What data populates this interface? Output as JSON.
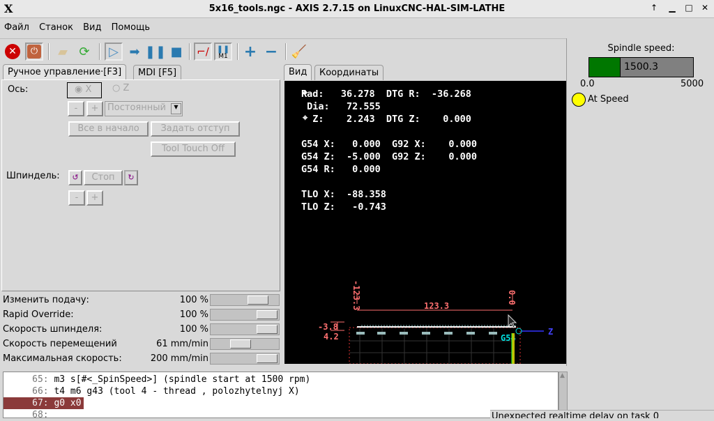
{
  "window": {
    "title": "5x16_tools.ngc - AXIS 2.7.15 on LinuxCNC-HAL-SIM-LATHE",
    "logo": "X"
  },
  "menu": [
    "Файл",
    "Станок",
    "Вид",
    "Помощь"
  ],
  "toolbar": {
    "icons": [
      "estop-icon",
      "power-icon",
      "open-file-icon",
      "reload-icon",
      "run-icon",
      "step-icon",
      "pause-icon",
      "stop-icon",
      "block-delete-icon",
      "optional-stop-icon",
      "zoom-in-icon",
      "zoom-out-icon",
      "clear-plot-icon"
    ],
    "m1_label": "M1"
  },
  "left_tabs": [
    "Ручное управление·[F3]",
    "MDI [F5]"
  ],
  "manual": {
    "axis_label": "Ось:",
    "axis_x": "X",
    "axis_z": "Z",
    "axis_selected": "X",
    "minus": "-",
    "plus": "+",
    "jog_mode": "Постоянный",
    "home_all": "Все в начало",
    "touch_off": "Задать отступ",
    "tool_touch_off": "Tool Touch Off",
    "spindle_label": "Шпиндель:",
    "spindle_stop": "Стоп"
  },
  "overrides": [
    {
      "name": "Изменить подачу:",
      "value": "100 %",
      "fraction": 0.8
    },
    {
      "name": "Rapid Override:",
      "value": "100 %",
      "fraction": 1.0
    },
    {
      "name": "Скорость шпинделя:",
      "value": "100 %",
      "fraction": 1.0
    },
    {
      "name": "Скорость перемещений",
      "value": "61 mm/min",
      "fraction": 0.4
    },
    {
      "name": "Максимальная скорость:",
      "value": "200 mm/min",
      "fraction": 1.0
    }
  ],
  "view_tabs": [
    "Вид",
    "Координаты"
  ],
  "dro": {
    "text": "Rad:   36.278  DTG R:  -36.268\n Dia:   72.555\n  Z:    2.243  DTG Z:    0.000\n\nG54 X:   0.000  G92 X:    0.000\nG54 Z:  -5.000  G92 Z:    0.000\nG54 R:   0.000\n\nTLO X:  -88.358\nTLO Z:   -0.743"
  },
  "plot": {
    "dim_x_top": "-123.3",
    "dim_zero": "0.0",
    "dim_length": "123.3",
    "dim_left_top": "-3.8",
    "dim_left_bottom": "4.2",
    "origin_label": "G54",
    "axis_label": "Z"
  },
  "spindle": {
    "label": "Spindle speed:",
    "value": "1500.3",
    "min": "0.0",
    "max": "5000",
    "fraction": 0.3,
    "at_speed": "At Speed",
    "at_speed_color": "#ffff00",
    "bar_color": "#007700"
  },
  "gcode": [
    {
      "n": "65:",
      "code": "m3 s[#<_SpinSpeed>] (spindle start at 1500 rpm)"
    },
    {
      "n": "66:",
      "code": "t4 m6 g43 (tool 4 - thread , polozhytelnyj X)"
    },
    {
      "n": "67:",
      "code": "g0 x0",
      "current": true
    },
    {
      "n": "68:",
      "code": ""
    }
  ],
  "status": "Unexpected realtime delay on task 0"
}
